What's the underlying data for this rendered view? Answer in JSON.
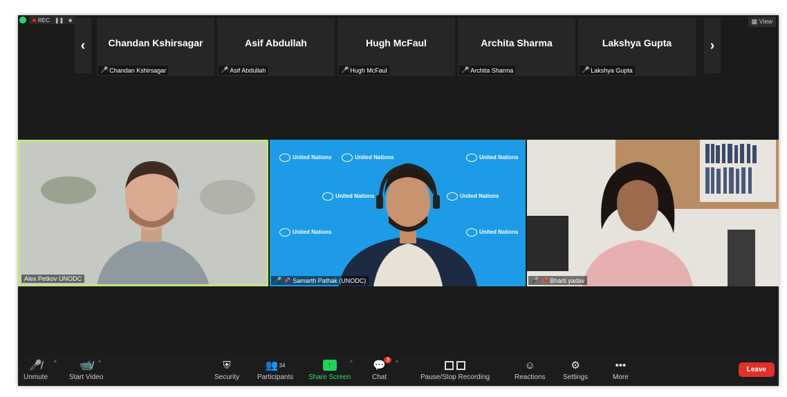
{
  "status": {
    "rec_label": "REC",
    "view_label": "View"
  },
  "strip": [
    {
      "name": "Chandan Kshirsagar",
      "label": "Chandan Kshirsagar"
    },
    {
      "name": "Asif Abdullah",
      "label": "Asif Abdullah"
    },
    {
      "name": "Hugh McFaul",
      "label": "Hugh McFaul"
    },
    {
      "name": "Archita Sharma",
      "label": "Archita Sharma"
    },
    {
      "name": "Lakshya Gupta",
      "label": "Lakshya Gupta"
    }
  ],
  "videos": {
    "alex": "Alex Petkov UNODC",
    "samarth": "Samarth Pathak (UNODC)",
    "bharti": "Bharti yadav"
  },
  "un_logo_text": "United Nations",
  "toolbar": {
    "unmute": "Unmute",
    "start_video": "Start Video",
    "security": "Security",
    "participants": "Participants",
    "participants_count": "34",
    "share_screen": "Share Screen",
    "chat": "Chat",
    "chat_badge": "3",
    "recording": "Pause/Stop Recording",
    "reactions": "Reactions",
    "settings": "Settings",
    "more": "More",
    "leave": "Leave"
  },
  "colors": {
    "active_speaker": "#c5e67a",
    "share_green": "#1ed35b",
    "leave_red": "#e0302a",
    "un_blue": "#1d9be6"
  }
}
